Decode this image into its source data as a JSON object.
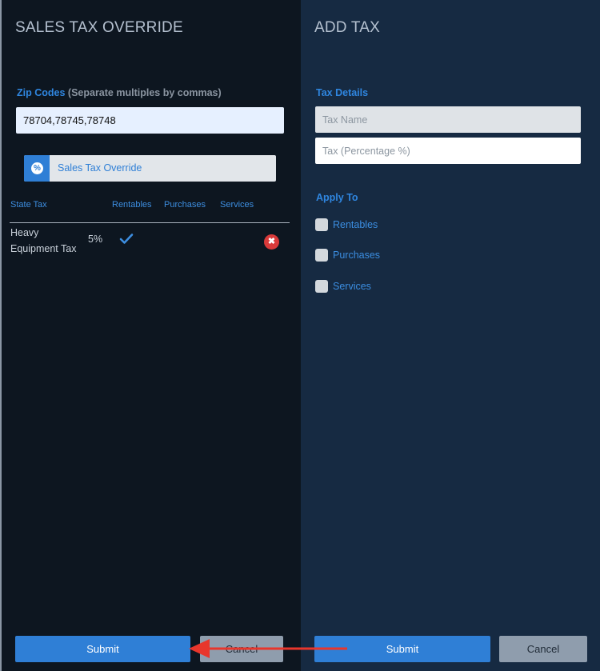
{
  "left_panel": {
    "title": "SALES TAX OVERRIDE",
    "zip_codes": {
      "label": "Zip Codes",
      "hint": "(Separate multiples by commas)",
      "value": "78704,78745,78748"
    },
    "override_toggle": {
      "icon": "percent-icon",
      "icon_glyph": "%",
      "label": "Sales Tax Override"
    },
    "table": {
      "columns": [
        "State Tax",
        "Rentables",
        "Purchases",
        "Services"
      ],
      "rows": [
        {
          "name": "Heavy Equipment Tax",
          "rate": "5%",
          "rentables": true,
          "purchases": false,
          "services": false,
          "delete_glyph": "✖"
        }
      ]
    },
    "buttons": {
      "submit": "Submit",
      "cancel": "Cancel"
    }
  },
  "right_panel": {
    "title": "ADD TAX",
    "tax_details_label": "Tax Details",
    "tax_name_placeholder": "Tax Name",
    "tax_percent_placeholder": "Tax (Percentage %)",
    "apply_to_label": "Apply To",
    "apply_to_options": [
      {
        "label": "Rentables",
        "checked": false
      },
      {
        "label": "Purchases",
        "checked": false
      },
      {
        "label": "Services",
        "checked": false
      }
    ],
    "buttons": {
      "submit": "Submit",
      "cancel": "Cancel"
    }
  },
  "colors": {
    "accent": "#2f7fd6",
    "left_bg": "#0d1620",
    "right_bg": "#162a42",
    "danger": "#d93a3a",
    "annotation_arrow": "#e8362c"
  }
}
